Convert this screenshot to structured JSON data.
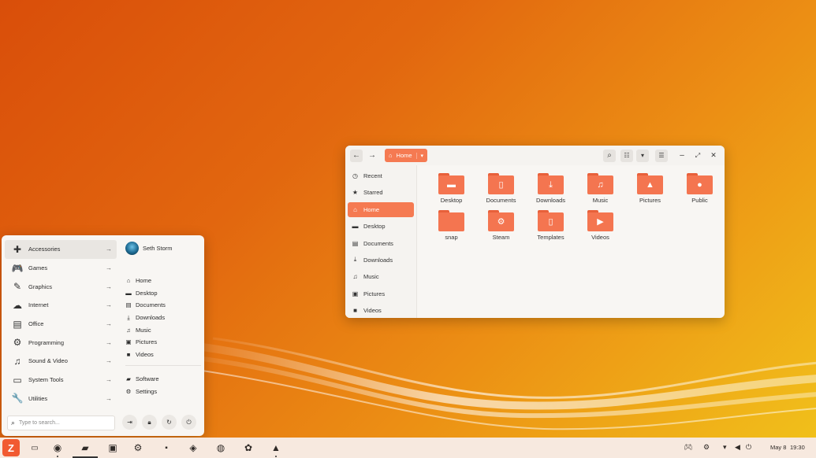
{
  "file_manager": {
    "path_label": "Home",
    "sidebar": [
      {
        "icon": "clock-icon",
        "glyph": "◷",
        "label": "Recent"
      },
      {
        "icon": "star-icon",
        "glyph": "★",
        "label": "Starred"
      },
      {
        "icon": "home-icon",
        "glyph": "⌂",
        "label": "Home",
        "active": true
      },
      {
        "icon": "desktop-icon",
        "glyph": "▬",
        "label": "Desktop"
      },
      {
        "icon": "document-icon",
        "glyph": "▤",
        "label": "Documents"
      },
      {
        "icon": "download-icon",
        "glyph": "⤓",
        "label": "Downloads"
      },
      {
        "icon": "music-icon",
        "glyph": "♫",
        "label": "Music"
      },
      {
        "icon": "picture-icon",
        "glyph": "▣",
        "label": "Pictures"
      },
      {
        "icon": "video-icon",
        "glyph": "■",
        "label": "Videos"
      }
    ],
    "files": [
      {
        "name": "Desktop",
        "icon": "desktop-folder-icon",
        "glyph": "▬"
      },
      {
        "name": "Documents",
        "icon": "documents-folder-icon",
        "glyph": "▯"
      },
      {
        "name": "Downloads",
        "icon": "downloads-folder-icon",
        "glyph": "⤓"
      },
      {
        "name": "Music",
        "icon": "music-folder-icon",
        "glyph": "♫"
      },
      {
        "name": "Pictures",
        "icon": "pictures-folder-icon",
        "glyph": "▲"
      },
      {
        "name": "Public",
        "icon": "public-folder-icon",
        "glyph": "●"
      },
      {
        "name": "snap",
        "icon": "folder-icon",
        "glyph": ""
      },
      {
        "name": "Steam",
        "icon": "steam-folder-icon",
        "glyph": "⚙"
      },
      {
        "name": "Templates",
        "icon": "templates-folder-icon",
        "glyph": "▯"
      },
      {
        "name": "Videos",
        "icon": "videos-folder-icon",
        "glyph": "▶"
      }
    ]
  },
  "app_menu": {
    "categories": [
      {
        "label": "Accessories",
        "icon": "puzzle-icon",
        "glyph": "✚",
        "selected": true
      },
      {
        "label": "Games",
        "icon": "gamepad-icon",
        "glyph": "🎮"
      },
      {
        "label": "Graphics",
        "icon": "brush-icon",
        "glyph": "✎"
      },
      {
        "label": "Internet",
        "icon": "cloud-icon",
        "glyph": "☁"
      },
      {
        "label": "Office",
        "icon": "document-icon",
        "glyph": "▤"
      },
      {
        "label": "Programming",
        "icon": "gear-icon",
        "glyph": "⚙"
      },
      {
        "label": "Sound & Video",
        "icon": "music-note-icon",
        "glyph": "♫"
      },
      {
        "label": "System Tools",
        "icon": "monitor-icon",
        "glyph": "▭"
      },
      {
        "label": "Utilities",
        "icon": "wrench-icon",
        "glyph": "🔧"
      }
    ],
    "user_name": "Seth Storm",
    "places": [
      {
        "label": "Home",
        "icon": "home-icon",
        "glyph": "⌂"
      },
      {
        "label": "Desktop",
        "icon": "desktop-icon",
        "glyph": "▬"
      },
      {
        "label": "Documents",
        "icon": "document-icon",
        "glyph": "▤"
      },
      {
        "label": "Downloads",
        "icon": "download-icon",
        "glyph": "⤓"
      },
      {
        "label": "Music",
        "icon": "music-icon",
        "glyph": "♫"
      },
      {
        "label": "Pictures",
        "icon": "picture-icon",
        "glyph": "▣"
      },
      {
        "label": "Videos",
        "icon": "video-icon",
        "glyph": "■"
      }
    ],
    "system": [
      {
        "label": "Software",
        "icon": "bag-icon",
        "glyph": "▰"
      },
      {
        "label": "Settings",
        "icon": "gear-icon",
        "glyph": "⚙"
      }
    ],
    "search_placeholder": "Type to search..."
  },
  "taskbar": {
    "tray_date": "May 8",
    "tray_time": "19:30"
  },
  "colors": {
    "accent": "#f57a52",
    "folder": "#f47550",
    "wallpaper_start": "#d94e0a",
    "wallpaper_end": "#f1c21b"
  }
}
